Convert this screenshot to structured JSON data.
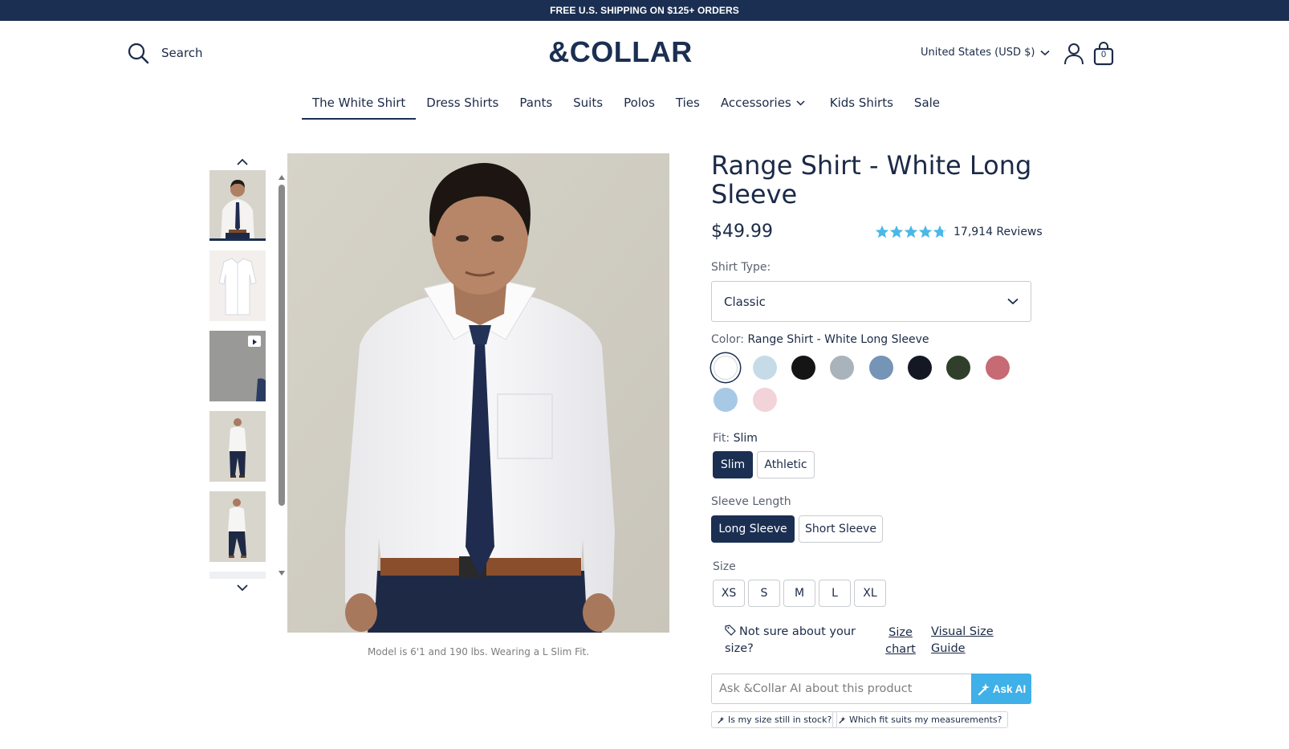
{
  "announcement": "FREE U.S. SHIPPING ON $125+ ORDERS",
  "header": {
    "search_label": "Search",
    "logo": "&COLLAR",
    "region": "United States (USD $)",
    "cart_count": "0"
  },
  "nav": {
    "items": [
      "The White Shirt",
      "Dress Shirts",
      "Pants",
      "Suits",
      "Polos",
      "Ties",
      "Accessories",
      "Kids Shirts",
      "Sale"
    ],
    "active": "The White Shirt"
  },
  "gallery": {
    "caption": "Model is 6'1 and 190 lbs. Wearing a L Slim Fit.",
    "thumbnail_count": 6,
    "selected_thumbnail": 1
  },
  "product": {
    "title": "Range Shirt - White Long Sleeve",
    "price": "$49.99",
    "rating": 4.8,
    "reviews": "17,914 Reviews",
    "shirt_type_label": "Shirt Type:",
    "shirt_type_value": "Classic",
    "color_label": "Color:",
    "color_value": "Range Shirt - White Long Sleeve",
    "swatches": [
      "#ffffff",
      "#c5dbe8",
      "#151515",
      "#a9b3bb",
      "#7594b6",
      "#141823",
      "#2f3f2b",
      "#c66a74",
      "#a8c9e6",
      "#f1d3d9"
    ],
    "fit_label": "Fit:",
    "fit_value": "Slim",
    "fit_options": [
      "Slim",
      "Athletic"
    ],
    "sleeve_label": "Sleeve Length",
    "sleeve_options": [
      "Long Sleeve",
      "Short Sleeve"
    ],
    "size_label": "Size",
    "size_options": [
      "XS",
      "S",
      "M",
      "L",
      "XL"
    ],
    "size_help": "Not sure about your size?",
    "size_chart_link": "Size chart",
    "visual_guide_link": "Visual Size Guide",
    "ask_placeholder": "Ask &Collar AI about this product",
    "ask_button": "Ask AI",
    "suggestions": [
      "Is my size still in stock?",
      "Which fit suits my measurements?"
    ]
  },
  "colors": {
    "navy": "#1b2f52",
    "accent_blue": "#3fb0e8",
    "star_blue": "#4bb8e6"
  }
}
